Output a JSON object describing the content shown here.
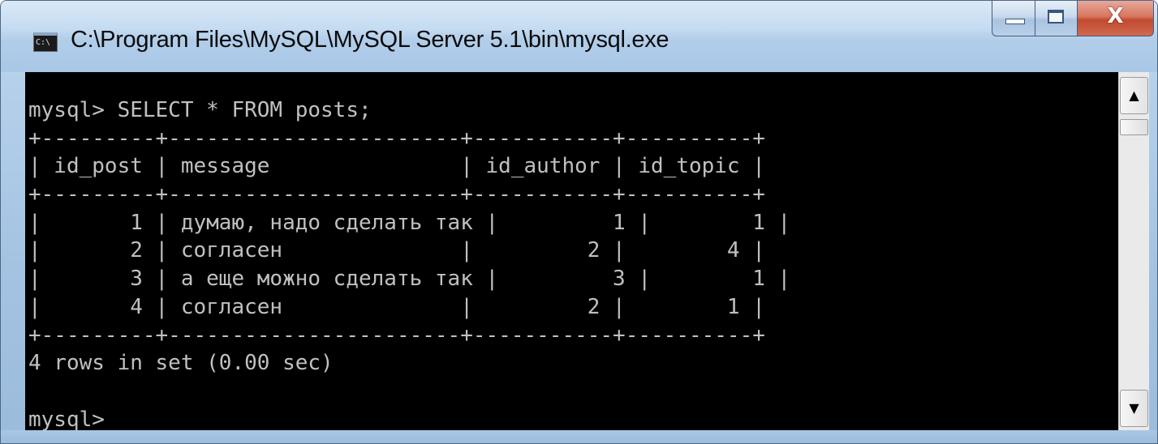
{
  "window": {
    "title": "C:\\Program Files\\MySQL\\MySQL Server 5.1\\bin\\mysql.exe",
    "icon": "cmd-console-icon",
    "icon_text": "C:\\",
    "controls": {
      "minimize": "minimize-icon",
      "maximize": "maximize-icon",
      "close_label": "X"
    }
  },
  "console": {
    "foreground": "#c0c0c0",
    "background": "#000000",
    "lines": [
      "mysql> SELECT * FROM posts;",
      "+---------+-----------------------+-----------+----------+",
      "| id_post | message               | id_author | id_topic |",
      "+---------+-----------------------+-----------+----------+",
      "|       1 | думаю, надо сделать так |         1 |        1 |",
      "|       2 | согласен              |         2 |        4 |",
      "|       3 | а еще можно сделать так |         3 |        1 |",
      "|       4 | согласен              |         2 |        1 |",
      "+---------+-----------------------+-----------+----------+",
      "4 rows in set (0.00 sec)",
      "",
      "mysql>"
    ],
    "query_result": {
      "query": "SELECT * FROM posts;",
      "columns": [
        "id_post",
        "message",
        "id_author",
        "id_topic"
      ],
      "rows": [
        [
          "1",
          "думаю, надо сделать так",
          "1",
          "1"
        ],
        [
          "2",
          "согласен",
          "2",
          "4"
        ],
        [
          "3",
          "а еще можно сделать так",
          "3",
          "1"
        ],
        [
          "4",
          "согласен",
          "2",
          "1"
        ]
      ],
      "summary": "4 rows in set (0.00 sec)",
      "prompt": "mysql>"
    }
  },
  "scrollbar": {
    "up_arrow": "▲",
    "down_arrow": "▼"
  }
}
